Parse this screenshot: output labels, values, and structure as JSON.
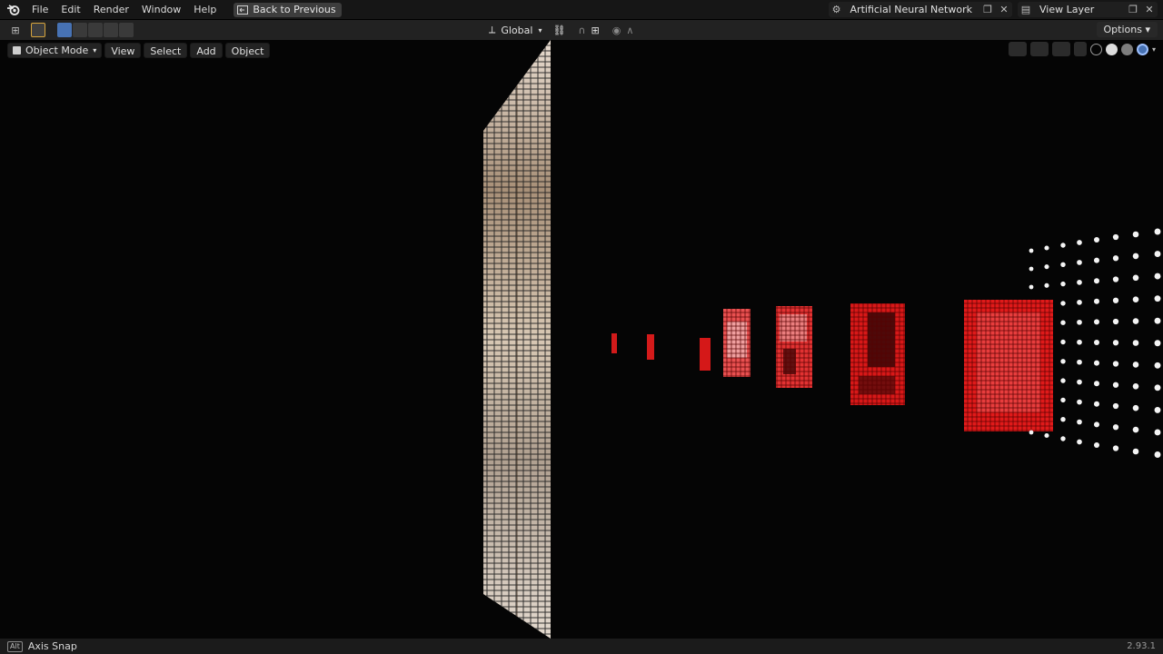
{
  "menubar": {
    "items": [
      "File",
      "Edit",
      "Render",
      "Window",
      "Help"
    ],
    "back_label": "Back to Previous",
    "scene_name": "Artificial Neural Network",
    "view_layer": "View Layer"
  },
  "toolbar": {
    "orientation": "Global",
    "options_label": "Options"
  },
  "viewport_header": {
    "mode": "Object Mode",
    "menus": [
      "View",
      "Select",
      "Add",
      "Object"
    ]
  },
  "statusbar": {
    "key": "Alt",
    "hint": "Axis Snap",
    "version": "2.93.1"
  },
  "colors": {
    "accent": "#4772b3",
    "neuron_active": "#e0181b",
    "header_bg": "#161616"
  }
}
